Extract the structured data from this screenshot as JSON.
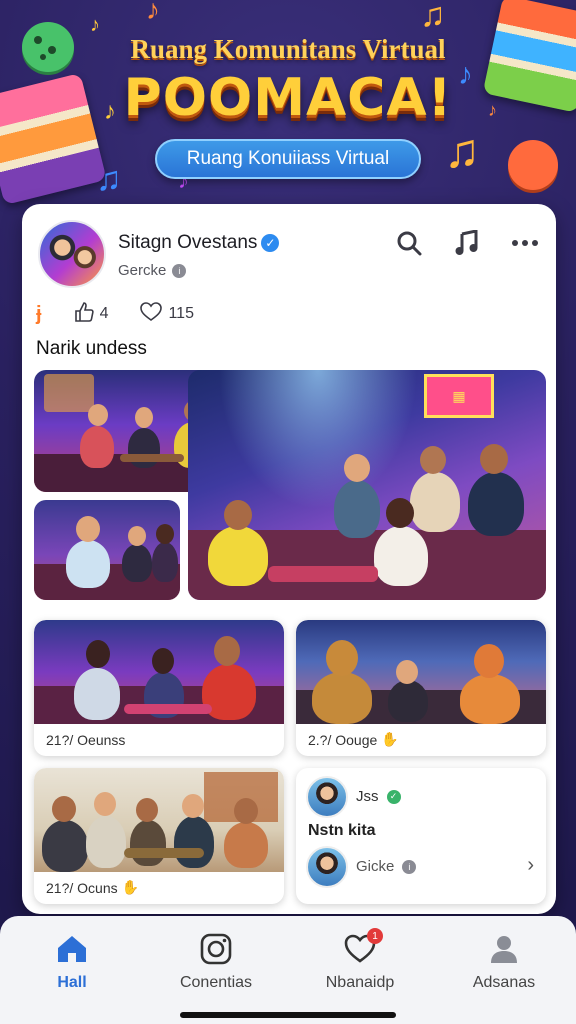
{
  "banner": {
    "title_top": "Ruang Komunitans Virtual",
    "brand": "POOMACA!",
    "pill_label": "Ruang Konuiiass Virtual"
  },
  "post": {
    "author_name": "Sitagn Ovestans",
    "author_sub": "Gercke",
    "stats": {
      "likes": "4",
      "hearts": "115"
    },
    "section_title": "Narik undess"
  },
  "tiles": [
    {
      "caption": "21?/ Oeunss",
      "emoji": ""
    },
    {
      "caption": "2.?/ Oouge",
      "emoji": "✋"
    },
    {
      "caption": "21?/ Ocuns",
      "emoji": "✋"
    }
  ],
  "side_card": {
    "user_name": "Jss",
    "title": "Nstn kita",
    "sub_name": "Gicke"
  },
  "nav": [
    {
      "label": "Hall",
      "icon": "home-icon"
    },
    {
      "label": "Conentias",
      "icon": "camera-icon"
    },
    {
      "label": "Nbanaidp",
      "icon": "heart-icon",
      "badge": "1"
    },
    {
      "label": "Adsanas",
      "icon": "profile-icon"
    }
  ],
  "colors": {
    "accent": "#2c6fd6",
    "background": "#2a2160",
    "brand_yellow": "#ffcf3a",
    "badge_red": "#e23a3a"
  }
}
